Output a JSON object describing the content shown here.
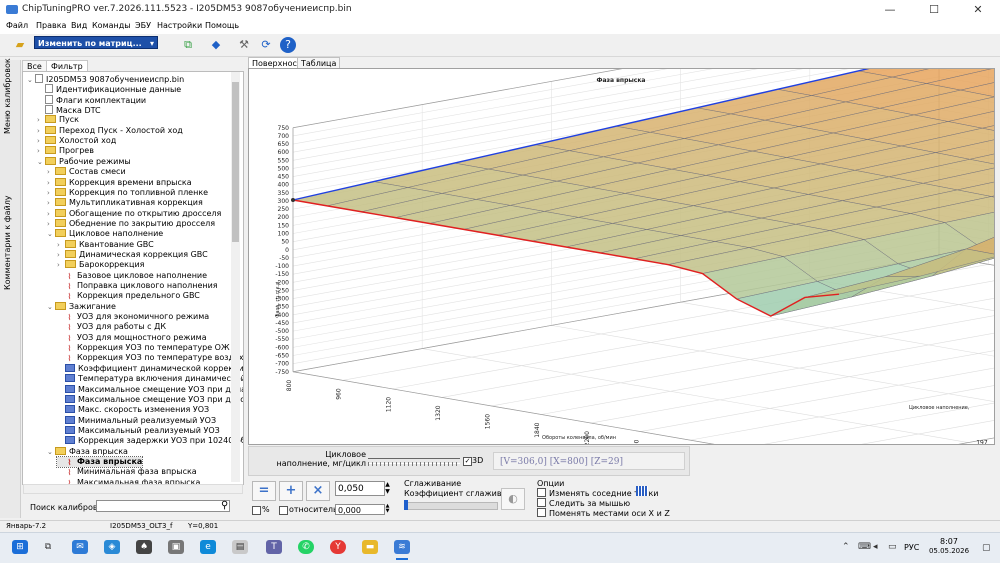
{
  "window": {
    "title": "ChipTuningPRO ver.7.2026.111.5523 - I205DM53 9087обучениеиспр.bin"
  },
  "menu": [
    "Файл",
    "Правка",
    "Вид",
    "Команды",
    "ЭБУ",
    "Настройки",
    "Помощь"
  ],
  "toolbar": {
    "mode_label": "Изменить по матриц..."
  },
  "left_tabs": {
    "calibrations": "Меню калибровок",
    "comments": "Комментарии к файлу"
  },
  "tree_tabs": [
    "Все",
    "Фильтр"
  ],
  "tree": [
    {
      "level": 0,
      "icon": "doc",
      "label": "I205DM53 9087обучениеиспр.bin",
      "exp": "v"
    },
    {
      "level": 1,
      "icon": "doc",
      "label": "Идентификационные данные"
    },
    {
      "level": 1,
      "icon": "doc",
      "label": "Флаги комплектации"
    },
    {
      "level": 1,
      "icon": "doc",
      "label": "Маска DTC"
    },
    {
      "level": 1,
      "icon": "folder",
      "label": "Пуск",
      "exp": ">"
    },
    {
      "level": 1,
      "icon": "folder",
      "label": "Переход Пуск - Холостой ход",
      "exp": ">"
    },
    {
      "level": 1,
      "icon": "folder",
      "label": "Холостой ход",
      "exp": ">"
    },
    {
      "level": 1,
      "icon": "folder",
      "label": "Прогрев",
      "exp": ">"
    },
    {
      "level": 1,
      "icon": "folder",
      "label": "Рабочие режимы",
      "exp": "v"
    },
    {
      "level": 2,
      "icon": "folder",
      "label": "Состав смеси",
      "exp": ">"
    },
    {
      "level": 2,
      "icon": "folder",
      "label": "Коррекция времени впрыска",
      "exp": ">"
    },
    {
      "level": 2,
      "icon": "folder",
      "label": "Коррекция по топливной пленке",
      "exp": ">"
    },
    {
      "level": 2,
      "icon": "folder",
      "label": "Мультипликативная коррекция",
      "exp": ">"
    },
    {
      "level": 2,
      "icon": "folder",
      "label": "Обогащение по открытию дросселя",
      "exp": ">"
    },
    {
      "level": 2,
      "icon": "folder",
      "label": "Обеднение по закрытию дросселя",
      "exp": ">"
    },
    {
      "level": 2,
      "icon": "folder",
      "label": "Цикловое наполнение",
      "exp": "v"
    },
    {
      "level": 3,
      "icon": "folder",
      "label": "Квантование GBC",
      "exp": ">"
    },
    {
      "level": 3,
      "icon": "folder",
      "label": "Динамическая коррекция GBC",
      "exp": ">"
    },
    {
      "level": 3,
      "icon": "folder",
      "label": "Барокоррекция",
      "exp": ">"
    },
    {
      "level": 3,
      "icon": "crv",
      "label": "Базовое цикловое наполнение"
    },
    {
      "level": 3,
      "icon": "crv",
      "label": "Поправка циклового наполнения"
    },
    {
      "level": 3,
      "icon": "crv",
      "label": "Коррекция предельного GBC"
    },
    {
      "level": 2,
      "icon": "folder",
      "label": "Зажигание",
      "exp": "v"
    },
    {
      "level": 3,
      "icon": "crv",
      "label": "УОЗ для экономичного режима"
    },
    {
      "level": 3,
      "icon": "crv",
      "label": "УОЗ для работы с ДК"
    },
    {
      "level": 3,
      "icon": "crv",
      "label": "УОЗ для мощностного режима"
    },
    {
      "level": 3,
      "icon": "crv",
      "label": "Коррекция УОЗ по температуре ОЖ"
    },
    {
      "level": 3,
      "icon": "crv",
      "label": "Коррекция УОЗ по температуре воздуха"
    },
    {
      "level": 3,
      "icon": "tbl",
      "label": "Коэффициент динамической коррекции"
    },
    {
      "level": 3,
      "icon": "tbl",
      "label": "Температура включения динамической к"
    },
    {
      "level": 3,
      "icon": "tbl",
      "label": "Максимальное смещение УОЗ при динами"
    },
    {
      "level": 3,
      "icon": "tbl",
      "label": "Максимальное смещение УОЗ при детона"
    },
    {
      "level": 3,
      "icon": "tbl",
      "label": "Макс. скорость изменения УОЗ"
    },
    {
      "level": 3,
      "icon": "tbl",
      "label": "Минимальный реализуемый УОЗ"
    },
    {
      "level": 3,
      "icon": "tbl",
      "label": "Максимальный реализуемый УОЗ"
    },
    {
      "level": 3,
      "icon": "tbl",
      "label": "Коррекция задержки УОЗ при 10240 об/м"
    },
    {
      "level": 2,
      "icon": "folder",
      "label": "Фаза впрыска",
      "exp": "v"
    },
    {
      "level": 3,
      "icon": "crv",
      "label": "Фаза впрыска",
      "selected": true
    },
    {
      "level": 3,
      "icon": "crv",
      "label": "Минимальная фаза впрыска"
    },
    {
      "level": 3,
      "icon": "crv",
      "label": "Максимальная фаза впрыска"
    }
  ],
  "search": {
    "label": "Поиск калибровки",
    "value": ""
  },
  "view_tabs": [
    "Поверхность",
    "Таблица"
  ],
  "chart_data": {
    "type": "surface",
    "title": "Фаза впрыска",
    "zlabel": "Фаза, гр.п.к.в.",
    "xlabel": "Обороты коленвала, об/мин",
    "ylabel": "Цикловое наполнение,",
    "z_ticks": [
      750,
      700,
      650,
      600,
      550,
      500,
      450,
      400,
      350,
      300,
      250,
      200,
      150,
      100,
      50,
      0,
      -50,
      -100,
      -150,
      -200,
      -250,
      -300,
      -350,
      -400,
      -450,
      -500,
      -550,
      -600,
      -650,
      -700,
      -750
    ],
    "x_ticks": [
      800,
      960,
      1120,
      1320,
      1560,
      1840,
      2200,
      2600,
      3040,
      3640,
      4280,
      5120
    ],
    "y_ticks": [
      421,
      365,
      309,
      253,
      197,
      141
    ],
    "zlim": [
      -750,
      750
    ],
    "front_edge_value": 306,
    "left_edge_rise": 500,
    "right_peak": 600
  },
  "controls": {
    "fill_label": "Цикловое наполнение, мг/цикл",
    "label_3d": "3D",
    "coords": "[V=306,0] [X=800] [Z=29]",
    "value": "0,050",
    "value2": "0,000",
    "percent_label": "%",
    "relative_label": "относительно",
    "smooth_title": "Сглаживание",
    "smooth_label": "Коэффициент сглаживания",
    "options_title": "Опции",
    "opt1": "Изменять соседние точки",
    "opt2": "Следить за мышью",
    "opt3": "Поменять местами оси X и Z"
  },
  "status": {
    "s1": "Январь-7.2",
    "s2": "I205DM53_OLT3_f",
    "s3": "Y=0,801"
  },
  "tray": {
    "lang": "РУС",
    "time": "8:07",
    "date": "05.05.2026"
  }
}
